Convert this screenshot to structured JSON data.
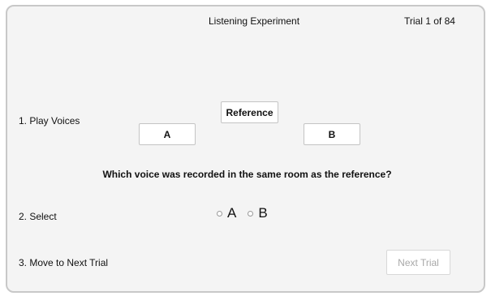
{
  "header": {
    "title": "Listening Experiment",
    "trial_counter": "Trial 1 of 84"
  },
  "steps": {
    "play_voices": "1. Play Voices",
    "select": "2. Select",
    "next": "3. Move to Next Trial"
  },
  "buttons": {
    "reference": "Reference",
    "voice_a": "A",
    "voice_b": "B",
    "next_trial": "Next Trial"
  },
  "question": "Which voice was recorded in the same room as the reference?",
  "options": [
    "A",
    "B"
  ]
}
